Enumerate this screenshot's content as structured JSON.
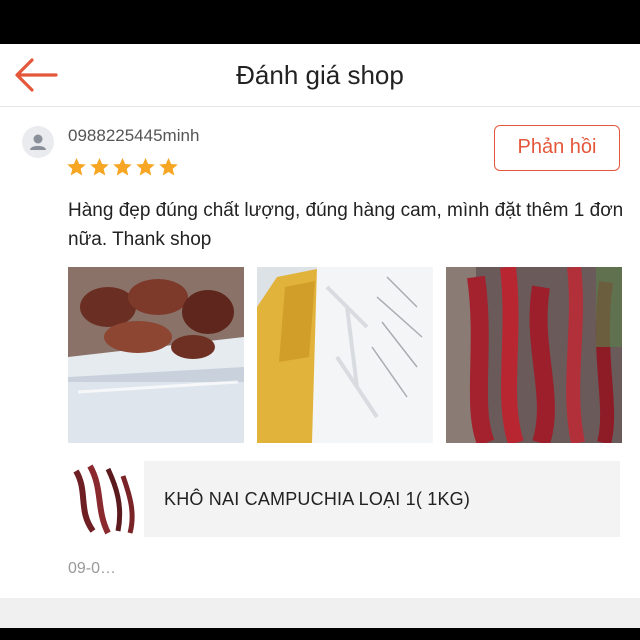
{
  "header": {
    "title": "Đánh giá shop",
    "back_icon": "arrow-left-icon",
    "accent_color": "#e4573a"
  },
  "review": {
    "username": "0988225445minh",
    "rating": 5,
    "max_rating": 5,
    "star_color": "#f6a623",
    "reply_label": "Phản hồi",
    "text": "Hàng đẹp đúng chất lượng, đúng hàng cam, mình đặt thêm 1 đơn nữa. Thank shop",
    "photos": [
      "product photo 1",
      "product photo 2",
      "product photo 3"
    ]
  },
  "product": {
    "name": "KHÔ NAI CAMPUCHIA LOẠI 1( 1KG)"
  },
  "date": "09-0…"
}
